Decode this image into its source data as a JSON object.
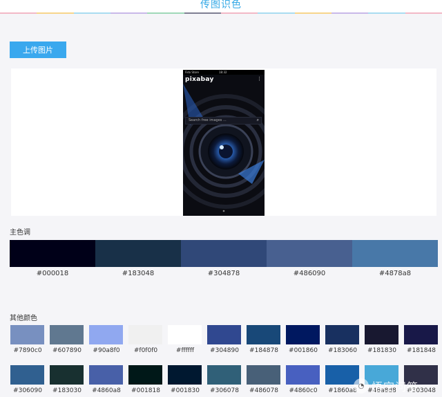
{
  "header": {
    "title": "传图识色"
  },
  "upload_button": {
    "label": "上传图片"
  },
  "phone": {
    "status_carrier": "Fido Store",
    "status_time": "18:32",
    "app_name": "pixabay",
    "search_placeholder": "Search free images ..."
  },
  "main_colors": {
    "label": "主色调",
    "items": [
      {
        "hex": "#000018",
        "color": "#000018"
      },
      {
        "hex": "#183048",
        "color": "#183048"
      },
      {
        "hex": "#304878",
        "color": "#304878"
      },
      {
        "hex": "#486090",
        "color": "#486090"
      },
      {
        "hex": "#4878a8",
        "color": "#4878a8"
      }
    ]
  },
  "other_colors": {
    "label": "其他颜色",
    "row1": [
      {
        "hex": "#7890c0",
        "color": "#7890c0"
      },
      {
        "hex": "#607890",
        "color": "#607890"
      },
      {
        "hex": "#90a8f0",
        "color": "#90a8f0"
      },
      {
        "hex": "#f0f0f0",
        "color": "#f0f0f0"
      },
      {
        "hex": "#ffffff",
        "color": "#ffffff"
      },
      {
        "hex": "#304890",
        "color": "#304890"
      },
      {
        "hex": "#184878",
        "color": "#184878"
      },
      {
        "hex": "#001860",
        "color": "#001860"
      },
      {
        "hex": "#183060",
        "color": "#183060"
      },
      {
        "hex": "#181830",
        "color": "#181830"
      },
      {
        "hex": "#181848",
        "color": "#181848"
      }
    ],
    "row2": [
      {
        "hex": "#306090",
        "color": "#306090"
      },
      {
        "hex": "#183030",
        "color": "#183030"
      },
      {
        "hex": "#4860a8",
        "color": "#4860a8"
      },
      {
        "hex": "#001818",
        "color": "#001818"
      },
      {
        "hex": "#001830",
        "color": "#001830"
      },
      {
        "hex": "#306078",
        "color": "#306078"
      },
      {
        "hex": "#486078",
        "color": "#486078"
      },
      {
        "hex": "#4860c0",
        "color": "#4860c0"
      },
      {
        "hex": "#1860a8",
        "color": "#1860a8"
      },
      {
        "hex": "#48a8d8",
        "color": "#48a8d8"
      },
      {
        "hex": "#303048",
        "color": "#303048"
      }
    ]
  },
  "watermark": {
    "text": "悟空问答"
  }
}
